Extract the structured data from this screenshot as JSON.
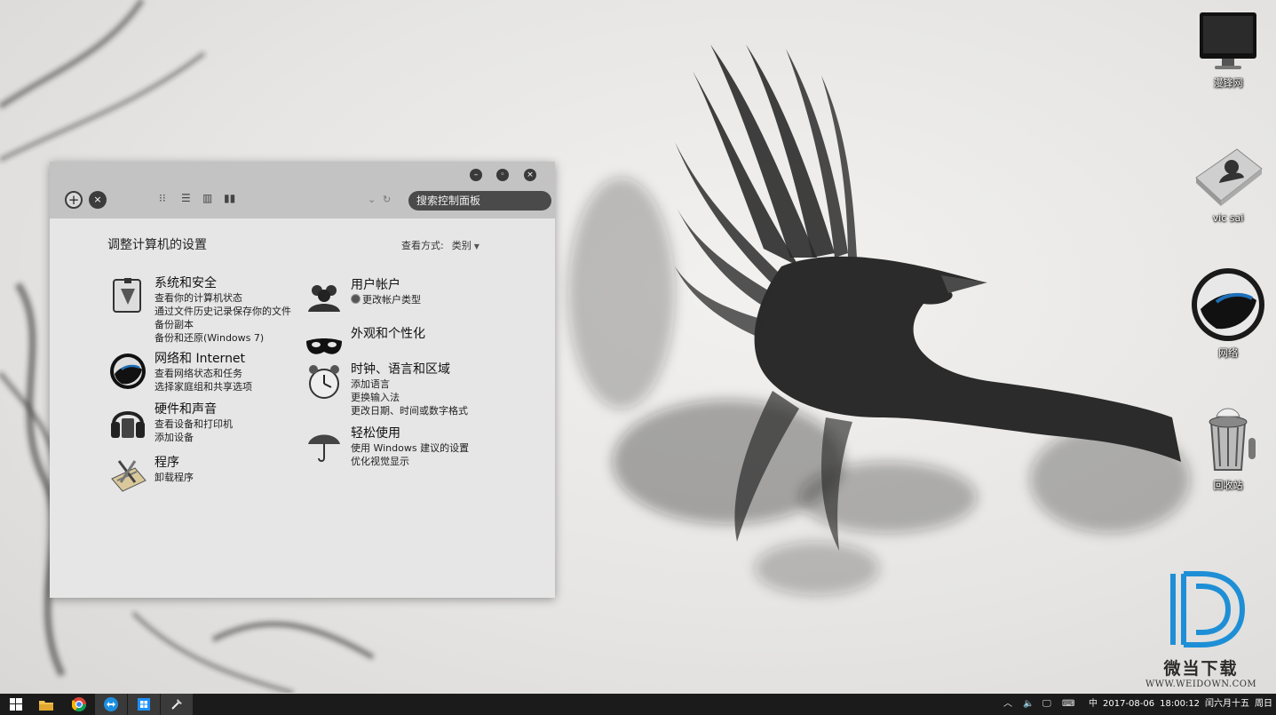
{
  "desktop": {
    "icons": [
      {
        "label": "漫锋网",
        "icon": "monitor-icon"
      },
      {
        "label": "vic sai",
        "icon": "user-folder-icon"
      },
      {
        "label": "网络",
        "icon": "network-globe-icon"
      },
      {
        "label": "回收站",
        "icon": "recycle-bin-icon"
      }
    ]
  },
  "window": {
    "search_placeholder": "搜索控制面板",
    "heading": "调整计算机的设置",
    "view_label": "查看方式:",
    "view_value": "类别",
    "left_categories": [
      {
        "title": "系统和安全",
        "links": [
          "查看你的计算机状态",
          "通过文件历史记录保存你的文件备份副本",
          "备份和还原(Windows 7)"
        ],
        "icon": "system-security-icon"
      },
      {
        "title": "网络和 Internet",
        "links": [
          "查看网络状态和任务",
          "选择家庭组和共享选项"
        ],
        "icon": "network-icon"
      },
      {
        "title": "硬件和声音",
        "links": [
          "查看设备和打印机",
          "添加设备"
        ],
        "icon": "hardware-sound-icon"
      },
      {
        "title": "程序",
        "links": [
          "卸载程序"
        ],
        "icon": "programs-icon"
      }
    ],
    "right_categories": [
      {
        "title": "用户帐户",
        "links": [
          "更改帐户类型"
        ],
        "icon": "user-accounts-icon"
      },
      {
        "title": "外观和个性化",
        "links": [],
        "icon": "appearance-mask-icon"
      },
      {
        "title": "时钟、语言和区域",
        "links": [
          "添加语言",
          "更换输入法",
          "更改日期、时间或数字格式"
        ],
        "icon": "clock-icon"
      },
      {
        "title": "轻松使用",
        "links": [
          "使用 Windows 建议的设置",
          "优化视觉显示"
        ],
        "icon": "ease-of-access-umbrella-icon"
      }
    ]
  },
  "taskbar": {
    "items": [
      "start-icon",
      "file-explorer-icon",
      "chrome-icon",
      "teamviewer-icon",
      "store-icon",
      "tools-icon"
    ],
    "ime": "中",
    "date": "2017-08-06",
    "time": "18:00:12",
    "lunar": "闰六月十五",
    "weekday": "周日"
  },
  "watermark": {
    "cn": "微当下载",
    "en": "WWW.WEIDOWN.COM",
    "brand_color": "#1e8fd6"
  }
}
